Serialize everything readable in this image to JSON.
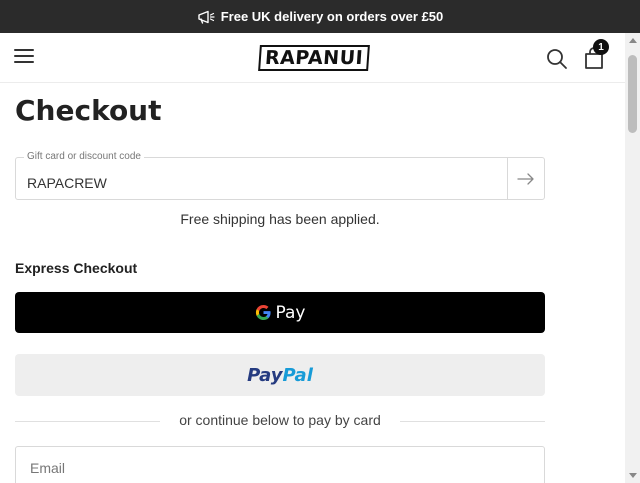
{
  "announcement": {
    "icon": "megaphone-icon",
    "text": "Free UK delivery on orders over £50"
  },
  "header": {
    "menu_icon": "hamburger-menu-icon",
    "logo_text": "RAPANUI",
    "search_icon": "search-icon",
    "cart_icon": "shopping-bag-icon",
    "cart_count": "1"
  },
  "page": {
    "title": "Checkout"
  },
  "discount": {
    "label": "Gift card or discount code",
    "value": "RAPACREW",
    "submit_icon": "arrow-right-icon",
    "message": "Free shipping has been applied."
  },
  "express": {
    "title": "Express Checkout",
    "gpay_label": "Pay",
    "paypal_part1": "Pay",
    "paypal_part2": "Pal"
  },
  "divider": {
    "text": "or continue below to pay by card"
  },
  "email": {
    "placeholder": "Email"
  },
  "colors": {
    "announcement_bg": "#2b2b2b",
    "gpay_bg": "#000000",
    "paypal_bg": "#eeeeee",
    "paypal_dark": "#253b80",
    "paypal_light": "#179bd7"
  }
}
